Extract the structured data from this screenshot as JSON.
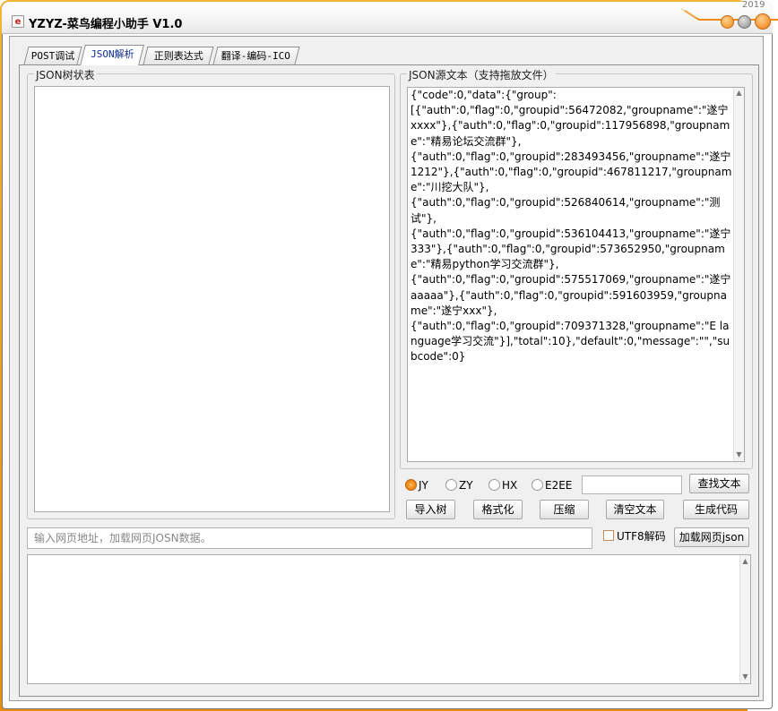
{
  "window": {
    "title": "YZYZ-菜鸟编程小助手 V1.0",
    "app_icon_glyph": "e",
    "year_label": "2019",
    "accent_color": "#ee8a16"
  },
  "tabs": [
    {
      "label": "POST调试",
      "active": false
    },
    {
      "label": "JSON解析",
      "active": true
    },
    {
      "label": "正则表达式",
      "active": false
    },
    {
      "label": "翻译-编码-ICO",
      "active": false
    }
  ],
  "tree_panel": {
    "legend": "JSON树状表"
  },
  "source_panel": {
    "legend": "JSON源文本（支持拖放文件）",
    "text": "{\"code\":0,\"data\":{\"group\":\n[{\"auth\":0,\"flag\":0,\"groupid\":56472082,\"groupname\":\"遂宁xxxx\"},{\"auth\":0,\"flag\":0,\"groupid\":117956898,\"groupname\":\"精易论坛交流群\"},\n{\"auth\":0,\"flag\":0,\"groupid\":283493456,\"groupname\":\"遂宁1212\"},{\"auth\":0,\"flag\":0,\"groupid\":467811217,\"groupname\":\"川挖大队\"},\n{\"auth\":0,\"flag\":0,\"groupid\":526840614,\"groupname\":\"测试\"},\n{\"auth\":0,\"flag\":0,\"groupid\":536104413,\"groupname\":\"遂宁333\"},{\"auth\":0,\"flag\":0,\"groupid\":573652950,\"groupname\":\"精易python学习交流群\"},\n{\"auth\":0,\"flag\":0,\"groupid\":575517069,\"groupname\":\"遂宁aaaaa\"},{\"auth\":0,\"flag\":0,\"groupid\":591603959,\"groupname\":\"遂宁xxx\"},\n{\"auth\":0,\"flag\":0,\"groupid\":709371328,\"groupname\":\"E language学习交流\"}],\"total\":10},\"default\":0,\"message\":\"\",\"subcode\":0}"
  },
  "radios": [
    {
      "label": "JY",
      "checked": true
    },
    {
      "label": "ZY",
      "checked": false
    },
    {
      "label": "HX",
      "checked": false
    },
    {
      "label": "E2EE",
      "checked": false
    }
  ],
  "search": {
    "value": "",
    "button": "查找文本"
  },
  "actions": {
    "import_tree": "导入树",
    "format": "格式化",
    "compress": "压缩",
    "clear_text": "清空文本",
    "generate_code": "生成代码"
  },
  "url_input": {
    "placeholder": "输入网页地址，加载网页JOSN数据。"
  },
  "utf8": {
    "label": "UTF8解码",
    "checked": false
  },
  "load_button": "加载网页json",
  "output": {
    "text": ""
  }
}
